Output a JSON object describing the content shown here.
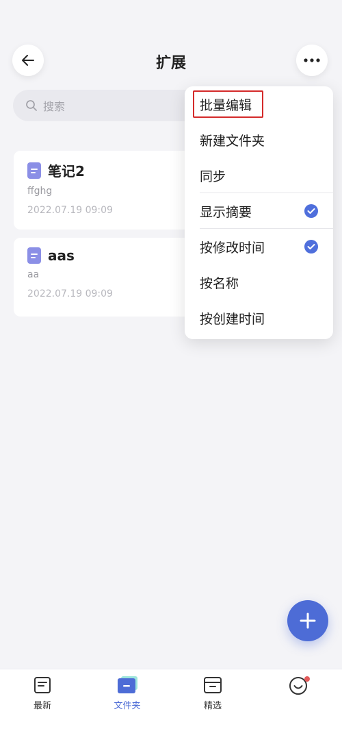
{
  "header": {
    "title": "扩展"
  },
  "search": {
    "placeholder": "搜索"
  },
  "notes": [
    {
      "title": "笔记2",
      "summary": "ffghg",
      "date": "2022.07.19 09:09"
    },
    {
      "title": "aas",
      "summary": "aa",
      "date": "2022.07.19 09:09"
    }
  ],
  "menu": {
    "items": [
      {
        "label": "批量编辑",
        "checked": false,
        "highlighted": true
      },
      {
        "label": "新建文件夹",
        "checked": false
      },
      {
        "label": "同步",
        "checked": false
      },
      {
        "label": "显示摘要",
        "checked": true
      },
      {
        "label": "按修改时间",
        "checked": true
      },
      {
        "label": "按名称",
        "checked": false
      },
      {
        "label": "按创建时间",
        "checked": false
      }
    ]
  },
  "tabbar": {
    "items": [
      {
        "label": "最新",
        "icon": "recent-icon",
        "active": false
      },
      {
        "label": "文件夹",
        "icon": "folder-icon",
        "active": true
      },
      {
        "label": "精选",
        "icon": "featured-icon",
        "active": false
      },
      {
        "label": "",
        "icon": "profile-icon",
        "active": false,
        "badge": true
      }
    ]
  },
  "colors": {
    "accent": "#4d6cd6",
    "highlight_border": "#d42a2a",
    "badge": "#e25b5b"
  }
}
